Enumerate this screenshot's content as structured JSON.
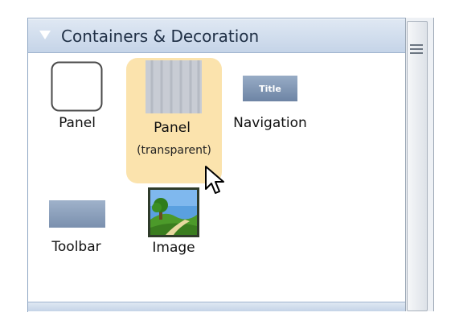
{
  "section": {
    "title": "Containers & Decoration"
  },
  "items": [
    {
      "label": "Panel",
      "icon": "panel-icon",
      "selected": false
    },
    {
      "label": "Panel",
      "sublabel": "(transparent)",
      "icon": "transparent-panel-icon",
      "selected": true
    },
    {
      "label": "Navigation",
      "icon": "navigation-bar-icon",
      "icon_text": "Title",
      "selected": false
    },
    {
      "label": "Toolbar",
      "icon": "toolbar-icon",
      "selected": false
    },
    {
      "label": "Image",
      "icon": "image-icon",
      "selected": false
    }
  ],
  "colors": {
    "header_gradient_top": "#dfe8f3",
    "header_gradient_bottom": "#c5d4e8",
    "selection": "#fbe3ad",
    "nav_icon": "#7f95b2"
  }
}
